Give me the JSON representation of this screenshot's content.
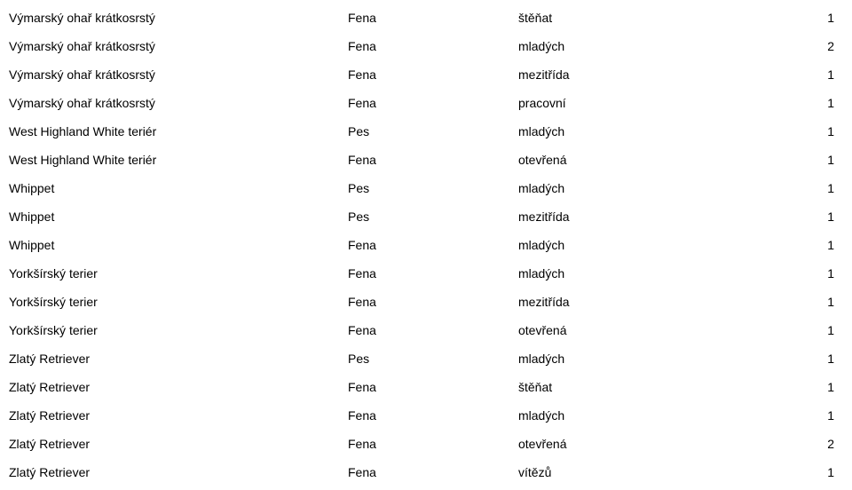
{
  "rows": [
    {
      "breed": "Výmarský ohař krátkosrstý",
      "sex": "Fena",
      "class": "štěňat",
      "count": "1"
    },
    {
      "breed": "Výmarský ohař krátkosrstý",
      "sex": "Fena",
      "class": "mladých",
      "count": "2"
    },
    {
      "breed": "Výmarský ohař krátkosrstý",
      "sex": "Fena",
      "class": "mezitřída",
      "count": "1"
    },
    {
      "breed": "Výmarský ohař krátkosrstý",
      "sex": "Fena",
      "class": "pracovní",
      "count": "1"
    },
    {
      "breed": "West Highland White teriér",
      "sex": "Pes",
      "class": "mladých",
      "count": "1"
    },
    {
      "breed": "West Highland White teriér",
      "sex": "Fena",
      "class": "otevřená",
      "count": "1"
    },
    {
      "breed": "Whippet",
      "sex": "Pes",
      "class": "mladých",
      "count": "1"
    },
    {
      "breed": "Whippet",
      "sex": "Pes",
      "class": "mezitřída",
      "count": "1"
    },
    {
      "breed": "Whippet",
      "sex": "Fena",
      "class": "mladých",
      "count": "1"
    },
    {
      "breed": "Yorkšírský terier",
      "sex": "Fena",
      "class": "mladých",
      "count": "1"
    },
    {
      "breed": "Yorkšírský terier",
      "sex": "Fena",
      "class": "mezitřída",
      "count": "1"
    },
    {
      "breed": "Yorkšírský terier",
      "sex": "Fena",
      "class": "otevřená",
      "count": "1"
    },
    {
      "breed": "Zlatý Retriever",
      "sex": "Pes",
      "class": "mladých",
      "count": "1"
    },
    {
      "breed": "Zlatý Retriever",
      "sex": "Fena",
      "class": "štěňat",
      "count": "1"
    },
    {
      "breed": "Zlatý Retriever",
      "sex": "Fena",
      "class": "mladých",
      "count": "1"
    },
    {
      "breed": "Zlatý Retriever",
      "sex": "Fena",
      "class": "otevřená",
      "count": "2"
    },
    {
      "breed": "Zlatý Retriever",
      "sex": "Fena",
      "class": "vítězů",
      "count": "1"
    }
  ]
}
